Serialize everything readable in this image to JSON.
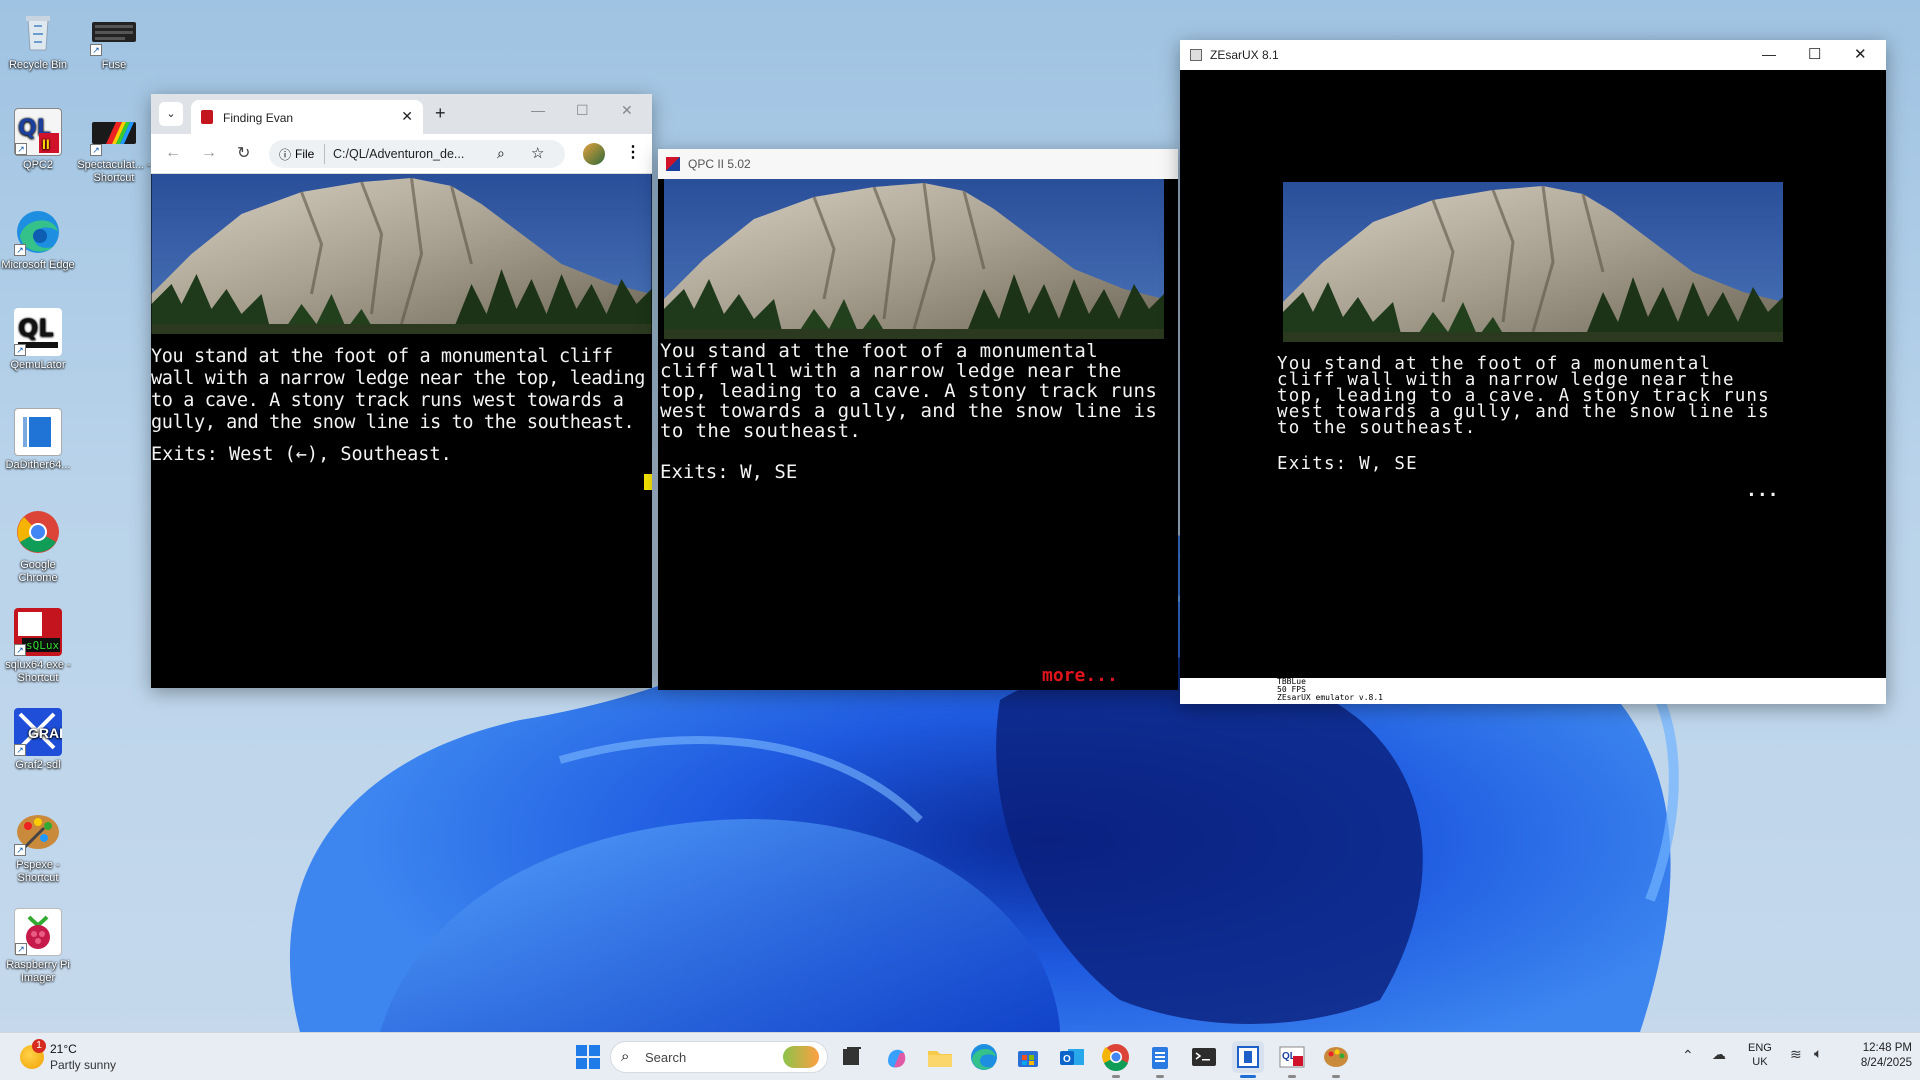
{
  "desktop_icons": [
    {
      "name": "recycle-bin",
      "label": "Recycle Bin"
    },
    {
      "name": "fuse",
      "label": "Fuse"
    },
    {
      "name": "qpc2",
      "label": "QPC2"
    },
    {
      "name": "spectaculator",
      "label": "Spectaculat... - Shortcut"
    },
    {
      "name": "edge",
      "label": "Microsoft Edge"
    },
    {
      "name": "qemulator",
      "label": "QemuLator"
    },
    {
      "name": "dadither",
      "label": "DaDither64..."
    },
    {
      "name": "chrome",
      "label": "Google Chrome"
    },
    {
      "name": "sqlux",
      "label": "sqlux64.exe - Shortcut"
    },
    {
      "name": "graf2",
      "label": "Graf2-sdl"
    },
    {
      "name": "pspexe",
      "label": "Pspexe - Shortcut"
    },
    {
      "name": "rpi-imager",
      "label": "Raspberry Pi Imager"
    }
  ],
  "chrome": {
    "tab_title": "Finding Evan",
    "file_label": "File",
    "url": "C:/QL/Adventuron_de...",
    "story": "You stand at the foot of a monumental cliff wall with a narrow ledge near the top, leading to a cave. A stony track runs west towards a gully, and the snow line is to the southeast.",
    "exits": "Exits: West (←), Southeast."
  },
  "qpc": {
    "title": "QPC II 5.02",
    "story": "You stand at the foot of a monumental\ncliff wall with a narrow ledge near the\ntop, leading to a cave. A stony track runs\nwest towards a gully, and the snow line is\nto the southeast.",
    "exits": "Exits: W, SE",
    "more": "more..."
  },
  "zesarux": {
    "title": "ZEsarUX 8.1",
    "story": "You stand at the foot of a monumental\ncliff wall with a narrow ledge near the\ntop, leading to a cave. A stony track runs\nwest towards a gully, and the snow line is\nto the southeast.",
    "exits": "Exits: W, SE",
    "ellipsis": "...",
    "status_line1": "TBBLue",
    "status_line2": "50 FPS",
    "status_line3": "ZEsarUX emulator v.8.1"
  },
  "taskbar": {
    "temp": "21°C",
    "weather": "Partly sunny",
    "weather_badge": "1",
    "search_placeholder": "Search",
    "lang1": "ENG",
    "lang2": "UK",
    "time": "12:48 PM",
    "date": "8/24/2025"
  }
}
